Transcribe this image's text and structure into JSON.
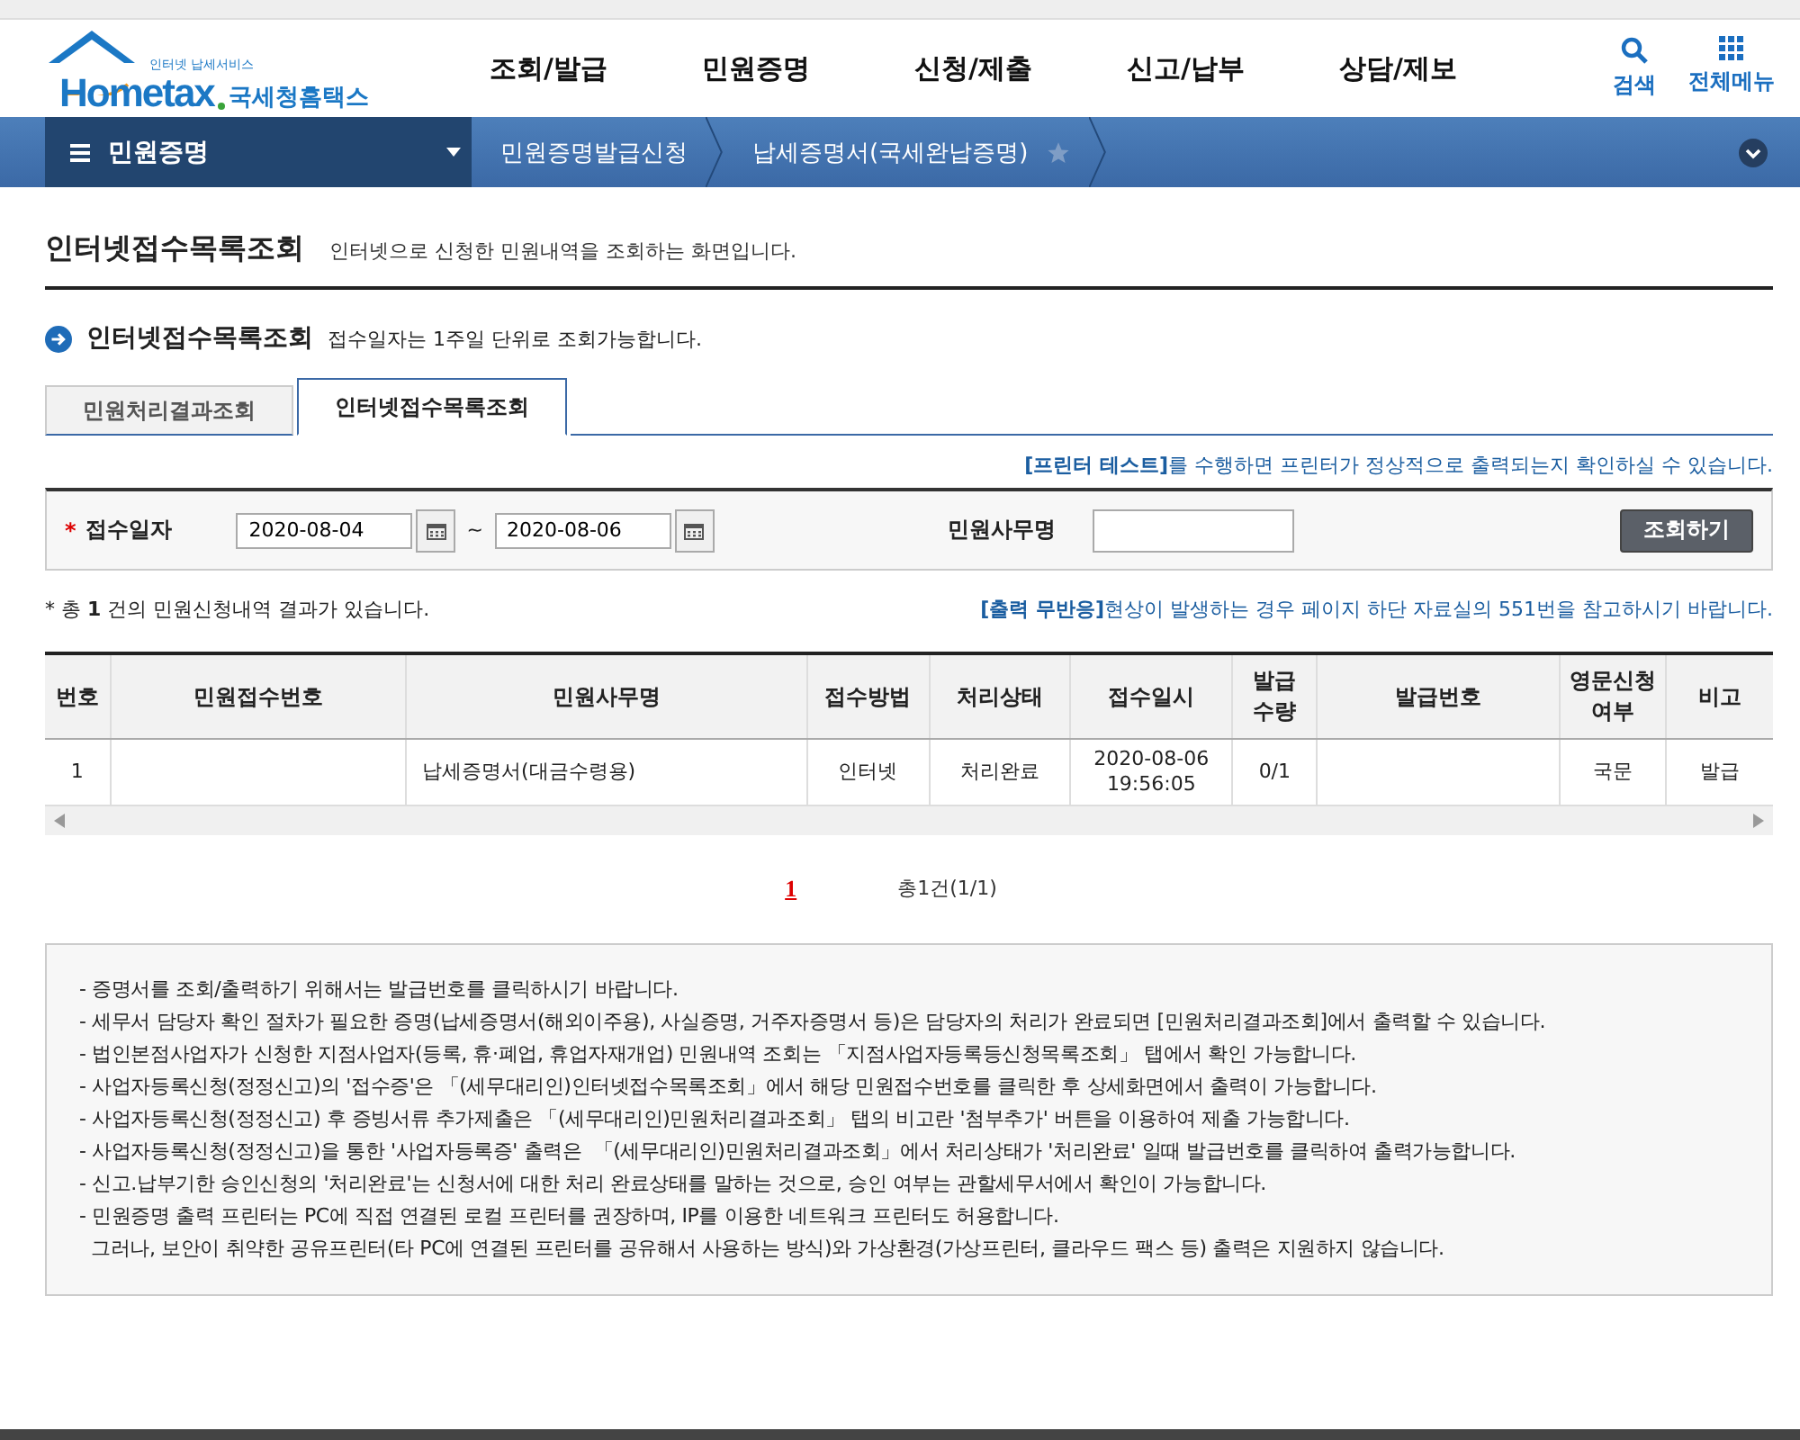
{
  "logo": {
    "tagline": "인터넷 납세서비스",
    "wordmark": "Hometax",
    "name": "국세청홈택스"
  },
  "nav": [
    "조회/발급",
    "민원증명",
    "신청/제출",
    "신고/납부",
    "상담/제보"
  ],
  "tools": [
    {
      "kind": "search",
      "label": "검색"
    },
    {
      "kind": "grid",
      "label": "전체메뉴"
    }
  ],
  "breadcrumb": {
    "menu": "민원증명",
    "items": [
      "민원증명발급신청",
      "납세증명서(국세완납증명)"
    ]
  },
  "page": {
    "title": "인터넷접수목록조회",
    "subtitle": "인터넷으로 신청한 민원내역을 조회하는 화면입니다."
  },
  "section": {
    "title": "인터넷접수목록조회",
    "note": "접수일자는 1주일 단위로 조회가능합니다."
  },
  "tabs": [
    {
      "label": "민원처리결과조회",
      "selected": false
    },
    {
      "label": "인터넷접수목록조회",
      "selected": true
    }
  ],
  "printer_note": "**[프린터 테스트]**를 수행하면 프린터가 정상적으로 출력되는지 확인하실 수 있습니다.",
  "search": {
    "required_mark": "*",
    "date_label": "접수일자",
    "date_from": "2020-08-04",
    "separator": "~",
    "date_to": "2020-08-06",
    "office_label": "민원사무명",
    "button": "조회하기"
  },
  "result_count": "* 총 **1** 건의 민원신청내역 결과가 있습니다.",
  "output_note": "**[출력 무반응]**현상이 발생하는 경우 페이지 하단 자료실의 551번을 참고하시기 바랍니다.",
  "table": {
    "columns": [
      "번호",
      "민원접수번호",
      "민원사무명",
      "접수방법",
      "처리상태",
      "접수일시",
      "발급\n수량",
      "발급번호",
      "영문신청\n여부",
      "비고"
    ],
    "rows": [
      [
        "1",
        "",
        "납세증명서(대금수령용)",
        "인터넷",
        "처리완료",
        "2020-08-06\n19:56:05",
        "0/1",
        "",
        "국문",
        "발급"
      ]
    ]
  },
  "pagination": {
    "pages": [
      {
        "label": "1",
        "selected": true
      }
    ],
    "summary": "총1건(1/1)"
  },
  "notes": [
    "- 증명서를 조회/출력하기 위해서는 발급번호를 클릭하시기 바랍니다.",
    "- 세무서 담당자 확인 절차가 필요한 증명(납세증명서(해외이주용), 사실증명, 거주자증명서 등)은 담당자의 처리가 완료되면 [민원처리결과조회]에서 출력할 수 있습니다.",
    "- 법인본점사업자가 신청한 지점사업자(등록, 휴·폐업, 휴업자재개업) 민원내역 조회는 「지점사업자등록등신청목록조회」 탭에서 확인 가능합니다.",
    "- 사업자등록신청(정정신고)의 '접수증'은 「(세무대리인)인터넷접수목록조회」에서 해당 민원접수번호를 클릭한 후 상세화면에서 출력이 가능합니다.",
    "- 사업자등록신청(정정신고) 후 증빙서류 추가제출은 「(세무대리인)민원처리결과조회」 탭의 비고란 '첨부추가' 버튼을 이용하여 제출 가능합니다.",
    "- 사업자등록신청(정정신고)을 통한 '사업자등록증' 출력은  「(세무대리인)민원처리결과조회」에서 처리상태가 '처리완료' 일때 발급번호를 클릭하여 출력가능합니다.",
    "- 신고.납부기한 승인신청의 '처리완료'는 신청서에 대한 처리 완료상태를 말하는 것으로, 승인 여부는 관할세무서에서 확인이 가능합니다.",
    "- 민원증명 출력 프린터는 PC에 직접 연결된 로컬 프린터를 권장하며, IP를 이용한 네트워크 프린터도 허용합니다.",
    "  그러나, 보안이 취약한 공유프린터(타 PC에 연결된 프린터를 공유해서 사용하는 방식)와 가상환경(가상프린터, 클라우드 팩스 등) 출력은 지원하지 않습니다."
  ]
}
